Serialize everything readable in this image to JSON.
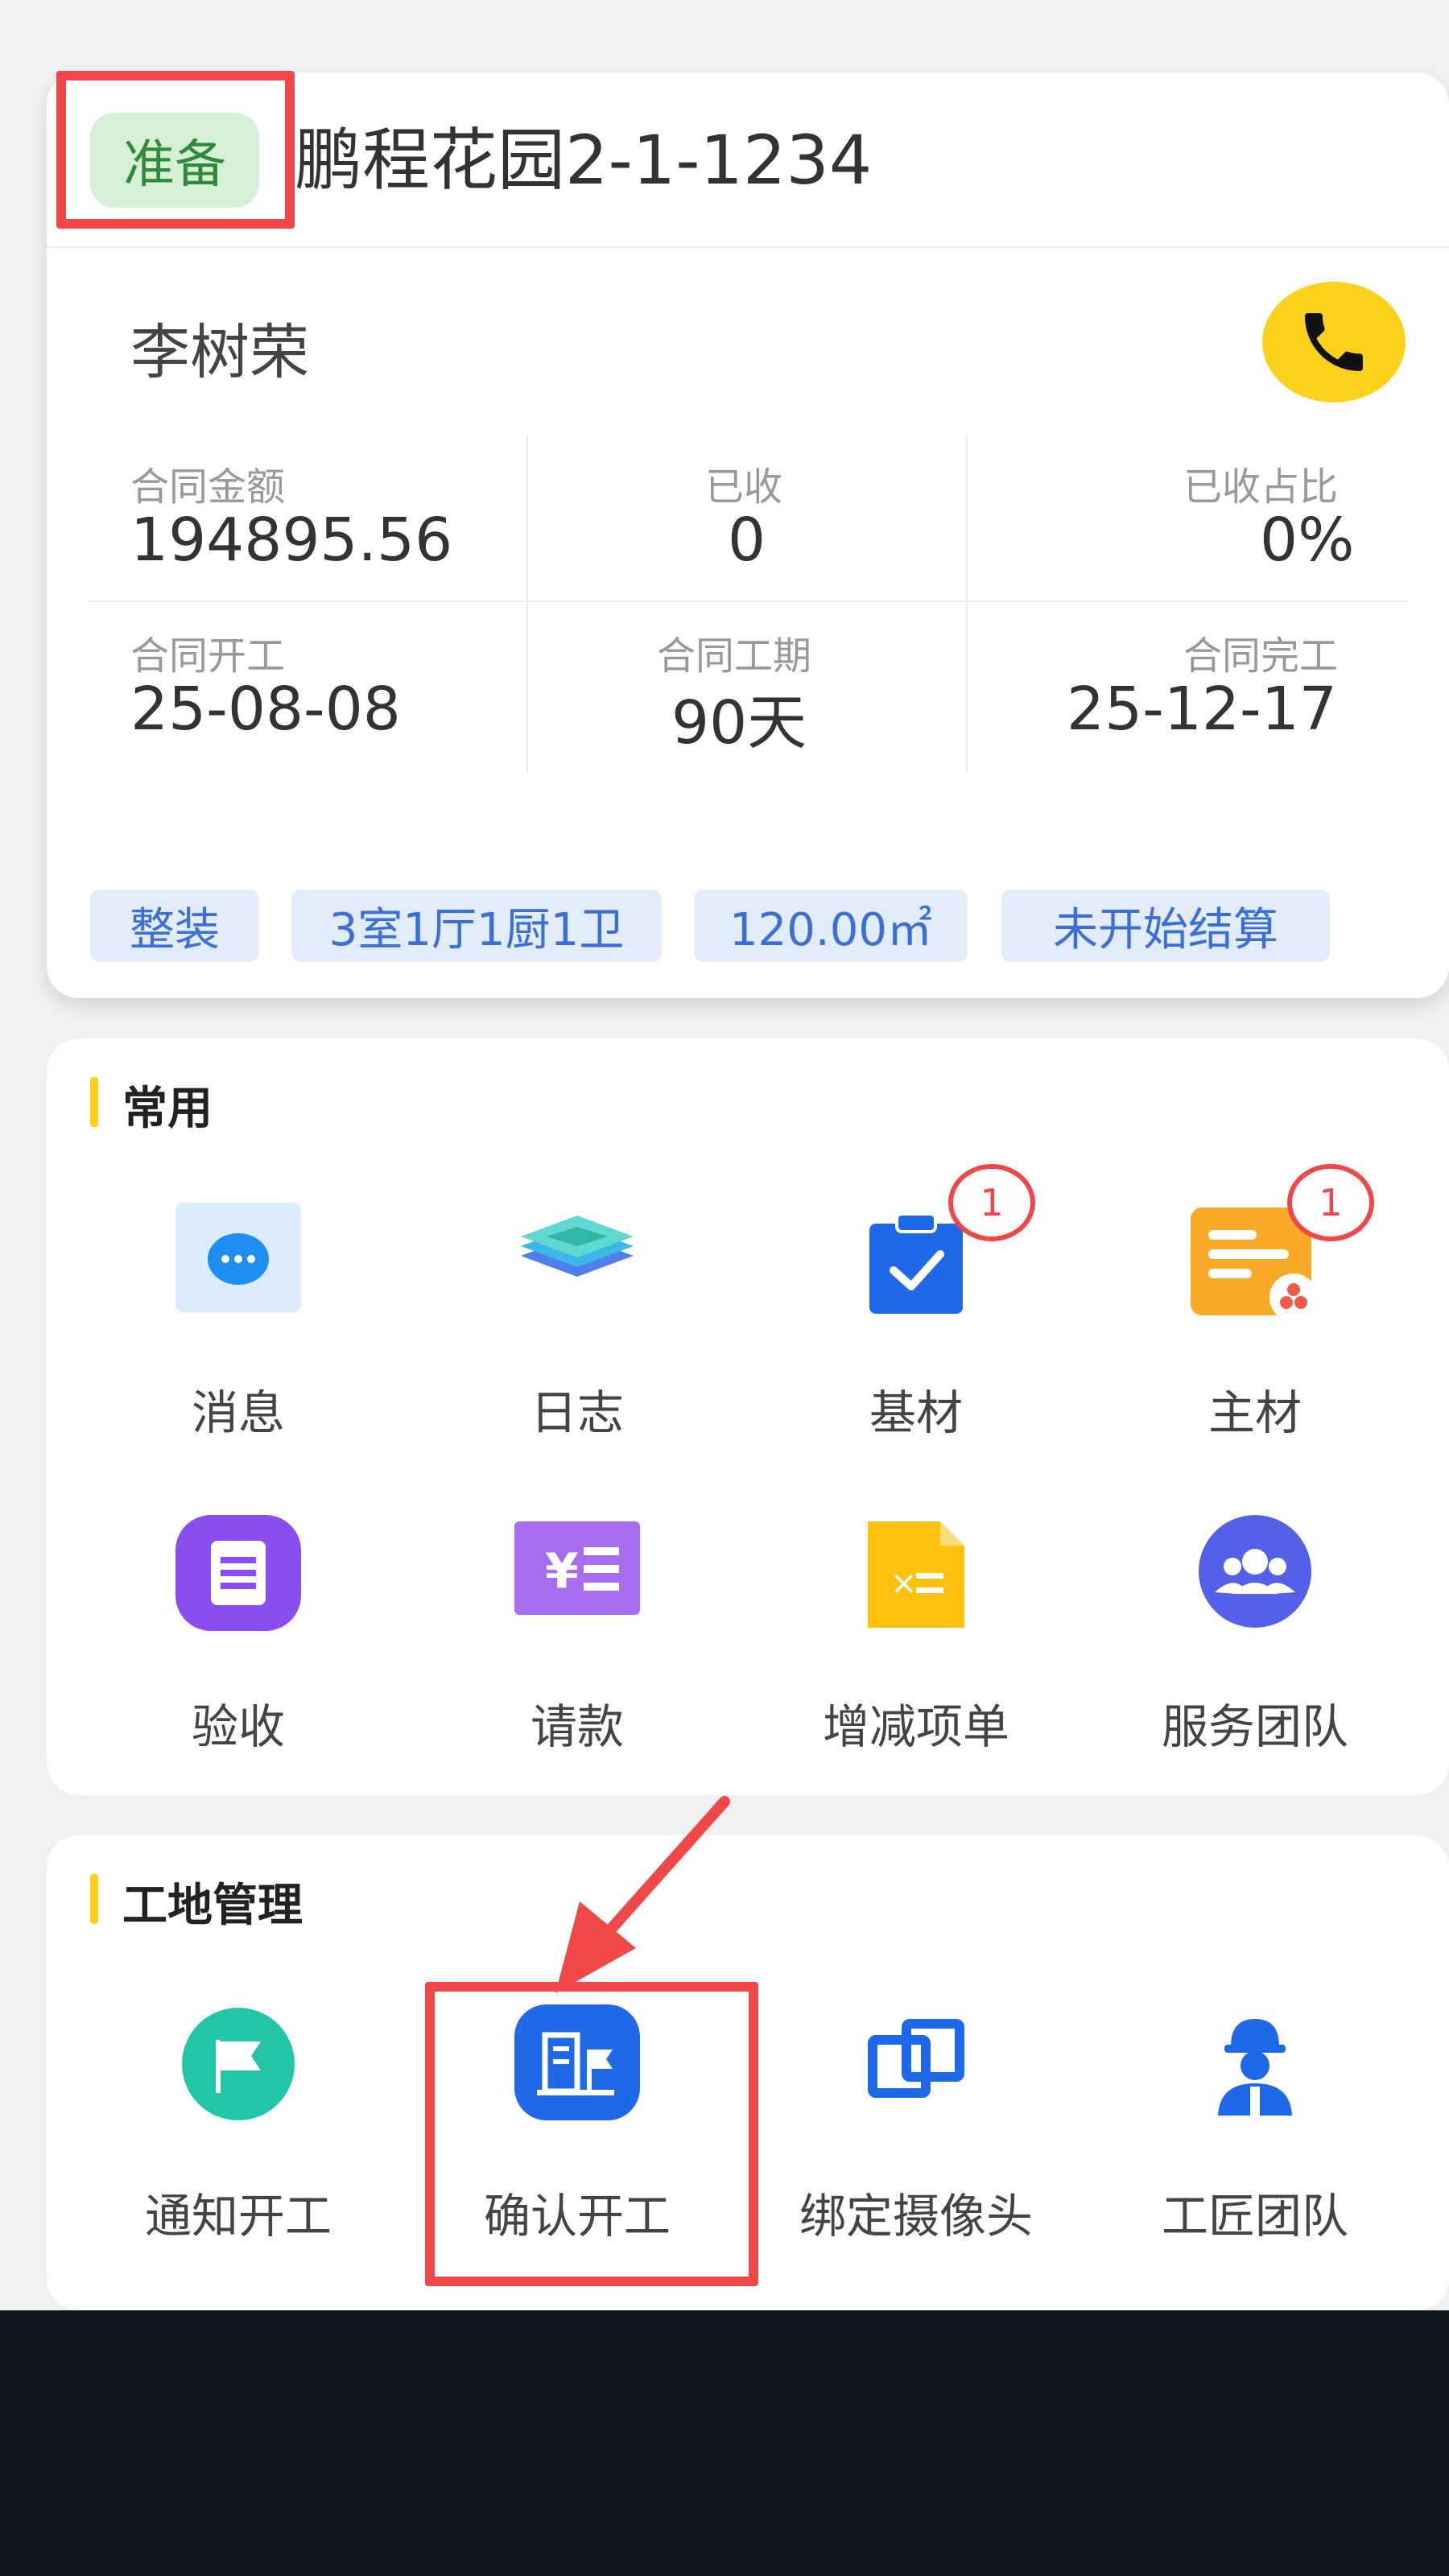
{
  "project": {
    "status": "准备",
    "title": "鹏程花园2-1-1234",
    "customer": "李树荣",
    "stats": [
      {
        "label": "合同金额",
        "value": "194895.56"
      },
      {
        "label": "已收",
        "value": "0"
      },
      {
        "label": "已收占比",
        "value": "0%"
      },
      {
        "label": "合同开工",
        "value": "25-08-08"
      },
      {
        "label": "合同工期",
        "value": "90天"
      },
      {
        "label": "合同完工",
        "value": "25-12-17"
      }
    ],
    "tags": [
      "整装",
      "3室1厅1厨1卫",
      "120.00㎡",
      "未开始结算"
    ]
  },
  "common": {
    "title": "常用",
    "items": [
      {
        "label": "消息",
        "icon": "message-icon"
      },
      {
        "label": "日志",
        "icon": "log-icon"
      },
      {
        "label": "基材",
        "icon": "base-material-icon",
        "badge": "1"
      },
      {
        "label": "主材",
        "icon": "main-material-icon",
        "badge": "1"
      },
      {
        "label": "验收",
        "icon": "acceptance-icon"
      },
      {
        "label": "请款",
        "icon": "payment-request-icon"
      },
      {
        "label": "增减项单",
        "icon": "change-order-icon"
      },
      {
        "label": "服务团队",
        "icon": "service-team-icon"
      }
    ]
  },
  "site": {
    "title": "工地管理",
    "items": [
      {
        "label": "通知开工",
        "icon": "notify-start-icon"
      },
      {
        "label": "确认开工",
        "icon": "confirm-start-icon"
      },
      {
        "label": "绑定摄像头",
        "icon": "bind-camera-icon"
      },
      {
        "label": "工匠团队",
        "icon": "craftsman-team-icon"
      }
    ]
  },
  "colors": {
    "accent": "#fcd11b",
    "highlight": "#f04848",
    "tag_text": "#3a6fd8",
    "status_badge_bg": "#d6f0d6"
  }
}
